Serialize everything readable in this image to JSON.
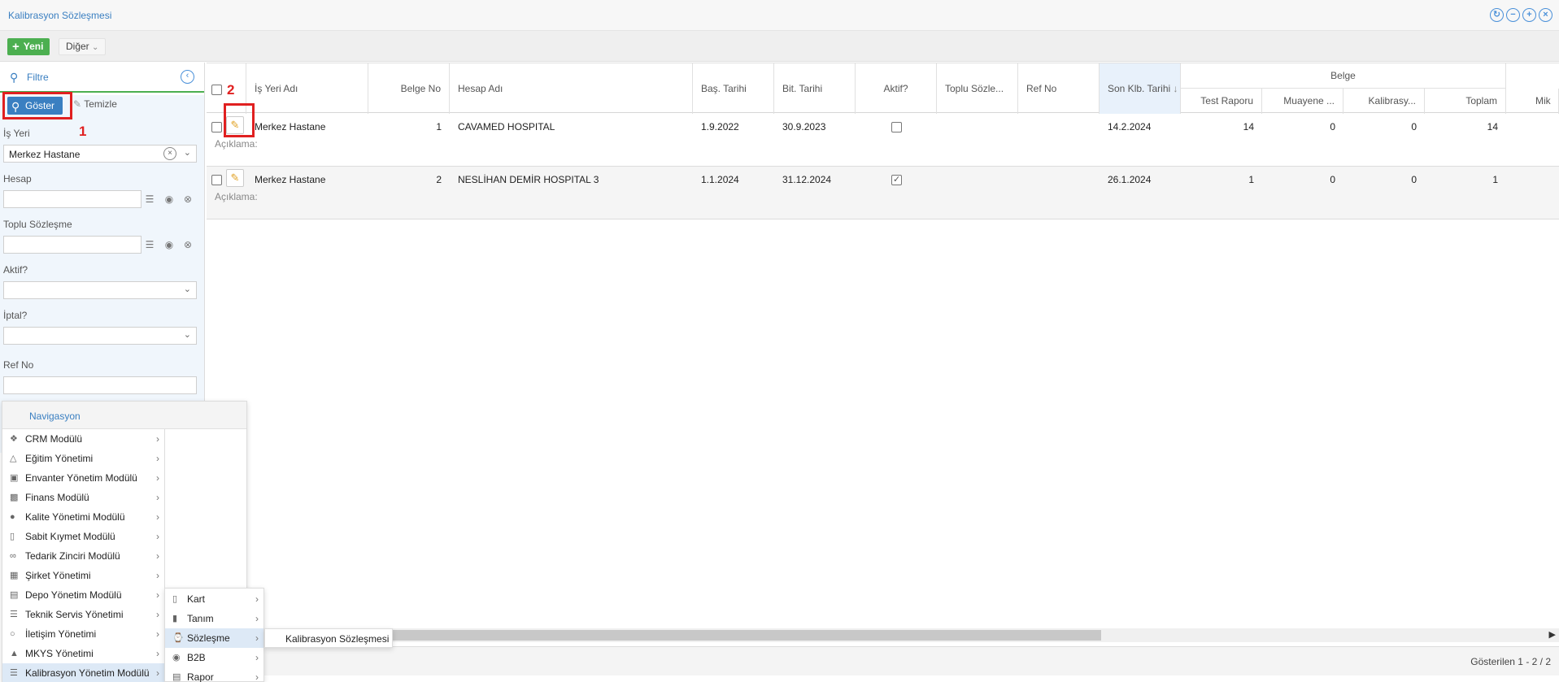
{
  "window": {
    "title": "Kalibrasyon Sözleşmesi"
  },
  "toolbar": {
    "new_label": "Yeni",
    "other_label": "Diğer"
  },
  "filter": {
    "title": "Filtre",
    "show_label": "Göster",
    "clear_label": "Temizle",
    "marker1": "1",
    "workplace_label": "İş Yeri",
    "workplace_value": "Merkez Hastane",
    "account_label": "Hesap",
    "bulk_label": "Toplu Sözleşme",
    "active_label": "Aktif?",
    "cancel_label": "İptal?",
    "refno_label": "Ref No"
  },
  "grid": {
    "marker2": "2",
    "columns": {
      "workplace": "İş Yeri Adı",
      "doc_no": "Belge No",
      "account": "Hesap Adı",
      "start": "Baş. Tarihi",
      "end": "Bit. Tarihi",
      "active": "Aktif?",
      "bulk": "Toplu Sözle...",
      "ref": "Ref No",
      "last_cal": "Son Klb. Tarihi",
      "group": "Belge",
      "test": "Test Raporu",
      "muayene": "Muayene ...",
      "kalib": "Kalibrasy...",
      "total": "Toplam",
      "mik": "Mik"
    },
    "desc_label": "Açıklama:",
    "rows": [
      {
        "workplace": "Merkez Hastane",
        "doc_no": "1",
        "account": "CAVAMED HOSPITAL",
        "start": "1.9.2022",
        "end": "30.9.2023",
        "active": false,
        "last_cal": "14.2.2024",
        "test": "14",
        "muayene": "0",
        "kalib": "0",
        "total": "14"
      },
      {
        "workplace": "Merkez Hastane",
        "doc_no": "2",
        "account": "NESLİHAN DEMİR HOSPITAL 3",
        "start": "1.1.2024",
        "end": "31.12.2024",
        "active": true,
        "last_cal": "26.1.2024",
        "test": "1",
        "muayene": "0",
        "kalib": "0",
        "total": "1"
      }
    ],
    "footer": "Gösterilen 1 - 2 / 2"
  },
  "nav": {
    "title": "Navigasyon",
    "items": [
      {
        "label": "CRM Modülü",
        "icon": "crm-icon"
      },
      {
        "label": "Eğitim Yönetimi",
        "icon": "graduation-cap-icon"
      },
      {
        "label": "Envanter Yönetim Modülü",
        "icon": "inventory-icon"
      },
      {
        "label": "Finans Modülü",
        "icon": "money-icon"
      },
      {
        "label": "Kalite Yönetimi Modülü",
        "icon": "globe-icon"
      },
      {
        "label": "Sabit Kıymet Modülü",
        "icon": "book-icon"
      },
      {
        "label": "Tedarik Zinciri Modülü",
        "icon": "chain-icon"
      },
      {
        "label": "Şirket Yönetimi",
        "icon": "building-icon"
      },
      {
        "label": "Depo Yönetim Modülü",
        "icon": "warehouse-icon"
      },
      {
        "label": "Teknik Servis Yönetimi",
        "icon": "list-icon"
      },
      {
        "label": "İletişim Yönetimi",
        "icon": "chat-icon"
      },
      {
        "label": "MKYS Yönetimi",
        "icon": "shield-icon"
      },
      {
        "label": "Kalibrasyon Yönetim Modülü",
        "icon": "list-icon"
      }
    ],
    "sub_items": [
      {
        "label": "Kart",
        "icon": "book-icon"
      },
      {
        "label": "Tanım",
        "icon": "bookmark-icon"
      },
      {
        "label": "Sözleşme",
        "icon": "paperclip-icon"
      },
      {
        "label": "B2B",
        "icon": "eye-icon"
      },
      {
        "label": "Rapor",
        "icon": "chart-icon"
      }
    ],
    "leaf": "Kalibrasyon Sözleşmesi"
  }
}
